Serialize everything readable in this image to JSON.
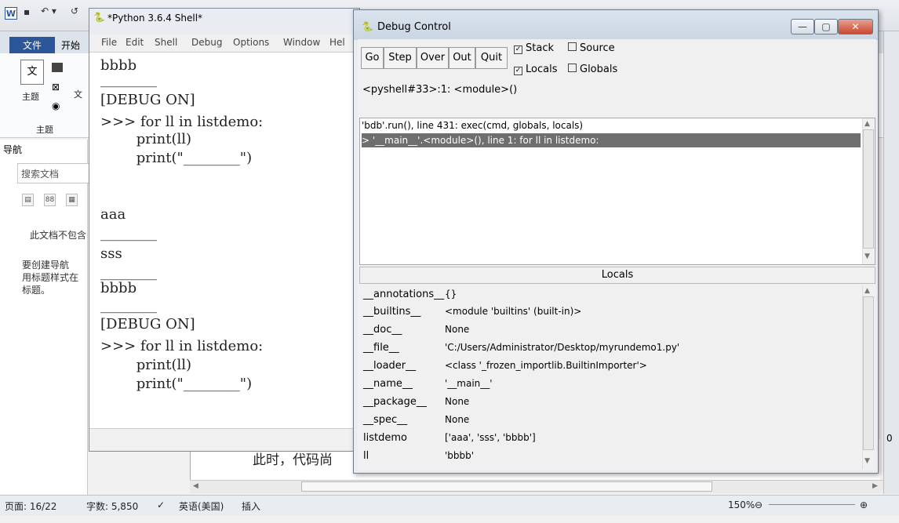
{
  "word": {
    "qat_icons": [
      "word-icon",
      "save-icon",
      "undo-icon"
    ],
    "tab_file": "文件",
    "tab_home": "开始",
    "ribbon": {
      "theme_label": "主题",
      "group_label": "主题",
      "side_char": "文"
    },
    "nav": {
      "title": "导航",
      "search_placeholder": "搜索文档",
      "tabs": [
        "▤",
        "88",
        "▦"
      ],
      "msg1": "此文档不包含",
      "msg2": "要创建导航",
      "msg3": "用标题样式在",
      "msg4": "标题。"
    },
    "doc_text": "此时，代码尚",
    "status": {
      "page": "页面: 16/22",
      "words": "字数: 5,850",
      "lang": "英语(美国)",
      "mode": "插入",
      "zoom": "150%"
    },
    "right_edge_num": "0"
  },
  "shell": {
    "title": "*Python 3.6.4 Shell*",
    "menu": [
      "File",
      "Edit",
      "Shell",
      "Debug",
      "Options",
      "Window",
      "Hel"
    ],
    "lines": [
      "bbbb",
      "________",
      "[DEBUG ON]",
      ">>> for ll in listdemo:",
      "        print(ll)",
      "        print(\"________\")",
      "aaa",
      "________",
      "sss",
      "________",
      "bbbb",
      "________",
      "[DEBUG ON]",
      ">>> for ll in listdemo:",
      "        print(ll)",
      "        print(\"________\")"
    ]
  },
  "debug": {
    "title": "Debug Control",
    "buttons": [
      "Go",
      "Step",
      "Over",
      "Out",
      "Quit"
    ],
    "checks": {
      "stack": {
        "label": "Stack",
        "checked": true
      },
      "source": {
        "label": "Source",
        "checked": false
      },
      "locals": {
        "label": "Locals",
        "checked": true
      },
      "globals": {
        "label": "Globals",
        "checked": false
      }
    },
    "status": "<pyshell#33>:1: <module>()",
    "stack": [
      "'bdb'.run(), line 431: exec(cmd, globals, locals)",
      "> '__main__'.<module>(), line 1: for ll in listdemo:"
    ],
    "locals_header": "Locals",
    "locals": [
      {
        "name": "__annotations__",
        "value": "{}"
      },
      {
        "name": "__builtins__",
        "value": "<module 'builtins' (built-in)>"
      },
      {
        "name": "__doc__",
        "value": "None"
      },
      {
        "name": "__file__",
        "value": "'C:/Users/Administrator/Desktop/myrundemo1.py'"
      },
      {
        "name": "__loader__",
        "value": "<class '_frozen_importlib.BuiltinImporter'>"
      },
      {
        "name": "__name__",
        "value": "'__main__'"
      },
      {
        "name": "__package__",
        "value": "None"
      },
      {
        "name": "__spec__",
        "value": "None"
      },
      {
        "name": "listdemo",
        "value": "['aaa', 'sss', 'bbbb']"
      },
      {
        "name": "ll",
        "value": "'bbbb'"
      }
    ]
  }
}
